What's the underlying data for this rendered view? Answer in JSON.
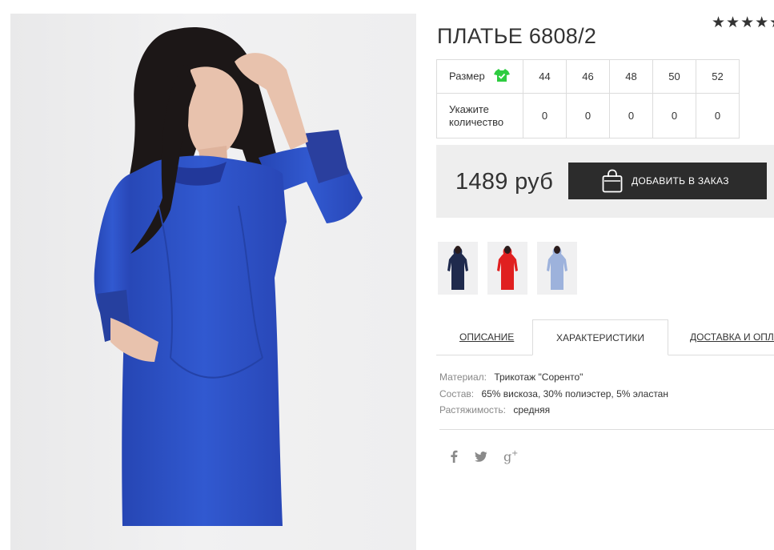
{
  "product": {
    "title": "ПЛАТЬЕ 6808/2",
    "rating_stars": "★★★★★",
    "rating_value": 5
  },
  "sizes_table": {
    "size_label": "Размер",
    "quantity_label": "Укажите количество",
    "sizes": [
      "44",
      "46",
      "48",
      "50",
      "52"
    ],
    "quantities": [
      "0",
      "0",
      "0",
      "0",
      "0"
    ]
  },
  "purchase": {
    "price": "1489 руб",
    "add_button_label": "ДОБАВИТЬ В ЗАКАЗ"
  },
  "thumbnails": [
    {
      "color": "#1f2a4d"
    },
    {
      "color": "#e02020"
    },
    {
      "color": "#9db2dc"
    }
  ],
  "tabs": {
    "description": "ОПИСАНИЕ",
    "characteristics": "ХАРАКТЕРИСТИКИ",
    "delivery": "ДОСТАВКА И ОПЛАТА"
  },
  "specs": [
    {
      "label": "Материал:",
      "value": "Трикотаж \"Соренто\""
    },
    {
      "label": "Состав:",
      "value": "65% вискоза, 30% полиэстер, 5% эластан"
    },
    {
      "label": "Растяжимость:",
      "value": "средняя"
    }
  ],
  "social": {
    "facebook": "f",
    "twitter": "🐦",
    "googleplus": "g+"
  },
  "colors": {
    "dress_blue": "#2f55c8",
    "button_dark": "#2c2c2c",
    "size_icon_green": "#2ecc40"
  }
}
